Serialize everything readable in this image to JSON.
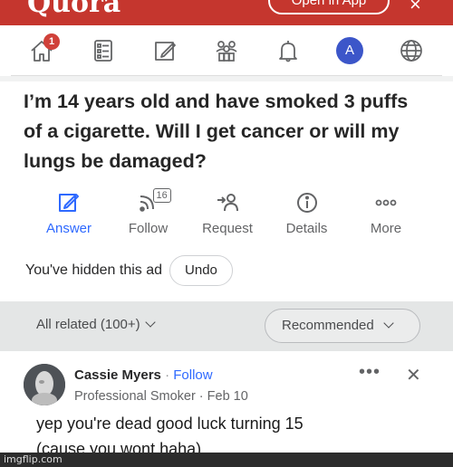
{
  "header": {
    "logo": "Quora",
    "open_app": "Open in App",
    "close_glyph": "×",
    "brand_color": "#c5362e"
  },
  "nav": {
    "notification_count": "1",
    "avatar_letter": "A",
    "icons": [
      "home-icon",
      "answer-feed-icon",
      "write-icon",
      "spaces-icon",
      "bell-icon",
      "profile-avatar",
      "globe-icon"
    ]
  },
  "question": {
    "title": "I’m 14 years old and have smoked 3 puffs of a cigarette. Will I get cancer or will my lungs be damaged?"
  },
  "actions": {
    "answer": "Answer",
    "follow": "Follow",
    "follow_count": "16",
    "request": "Request",
    "details": "Details",
    "more": "More",
    "accent": "#2e69ff"
  },
  "ad": {
    "hidden_text": "You've hidden this ad",
    "undo": "Undo"
  },
  "related": {
    "label": "All related (100+)",
    "sort": "Recommended"
  },
  "answer": {
    "author": "Cassie Myers",
    "separator": "·",
    "follow": "Follow",
    "credential": "Professional Smoker",
    "date": "Feb 10",
    "meta_separator": " · ",
    "more": "•••",
    "close": "✕",
    "line1": "yep you're dead good luck turning 15",
    "line2": "(cause you wont haha)"
  },
  "footer": {
    "watermark": "imgflip.com"
  }
}
